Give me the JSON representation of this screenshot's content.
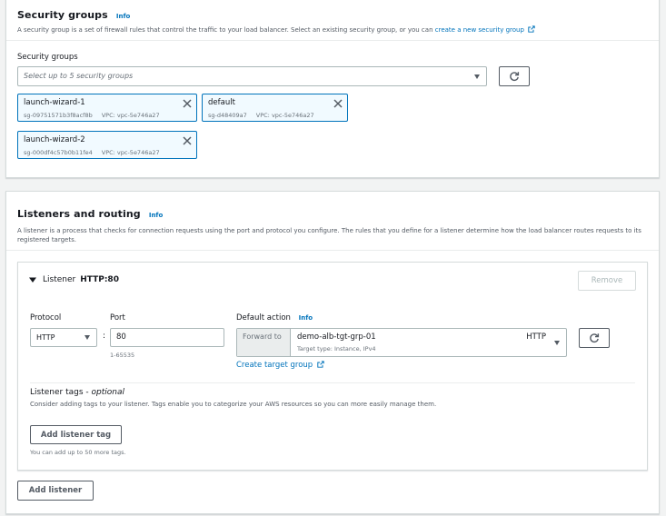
{
  "security_groups": {
    "title": "Security groups",
    "info": "Info",
    "description": "A security group is a set of firewall rules that control the traffic to your load balancer. Select an existing security group, or you can",
    "create_link": "create a new security group",
    "field_label": "Security groups",
    "select_placeholder": "Select up to 5 security groups",
    "tokens": [
      {
        "name": "launch-wizard-1",
        "id": "sg-09751571b3f8acf8b",
        "vpc": "VPC: vpc-5e746a27"
      },
      {
        "name": "default",
        "id": "sg-d48409a7",
        "vpc": "VPC: vpc-5e746a27"
      },
      {
        "name": "launch-wizard-2",
        "id": "sg-000df4c57b0b11fe4",
        "vpc": "VPC: vpc-5e746a27"
      }
    ]
  },
  "listeners": {
    "title": "Listeners and routing",
    "info": "Info",
    "description": "A listener is a process that checks for connection requests using the port and protocol you configure. The rules that you define for a listener determine how the load balancer routes requests to its registered targets.",
    "listener": {
      "prefix": "Listener",
      "name": "HTTP:80",
      "remove_label": "Remove",
      "protocol_label": "Protocol",
      "protocol_value": "HTTP",
      "colon": ":",
      "port_label": "Port",
      "port_value": "80",
      "port_hint": "1-65535",
      "default_action_label": "Default action",
      "default_action_info": "Info",
      "forward_to": "Forward to",
      "target_group": "demo-alb-tgt-grp-01",
      "target_type": "Target type: Instance, IPv4",
      "target_protocol": "HTTP",
      "create_target_group": "Create target group",
      "tags_title": "Listener tags -",
      "tags_optional": "optional",
      "tags_description": "Consider adding tags to your listener. Tags enable you to categorize your AWS resources so you can more easily manage them.",
      "add_tag_label": "Add listener tag",
      "tags_hint": "You can add up to 50 more tags."
    },
    "add_listener_label": "Add listener"
  }
}
